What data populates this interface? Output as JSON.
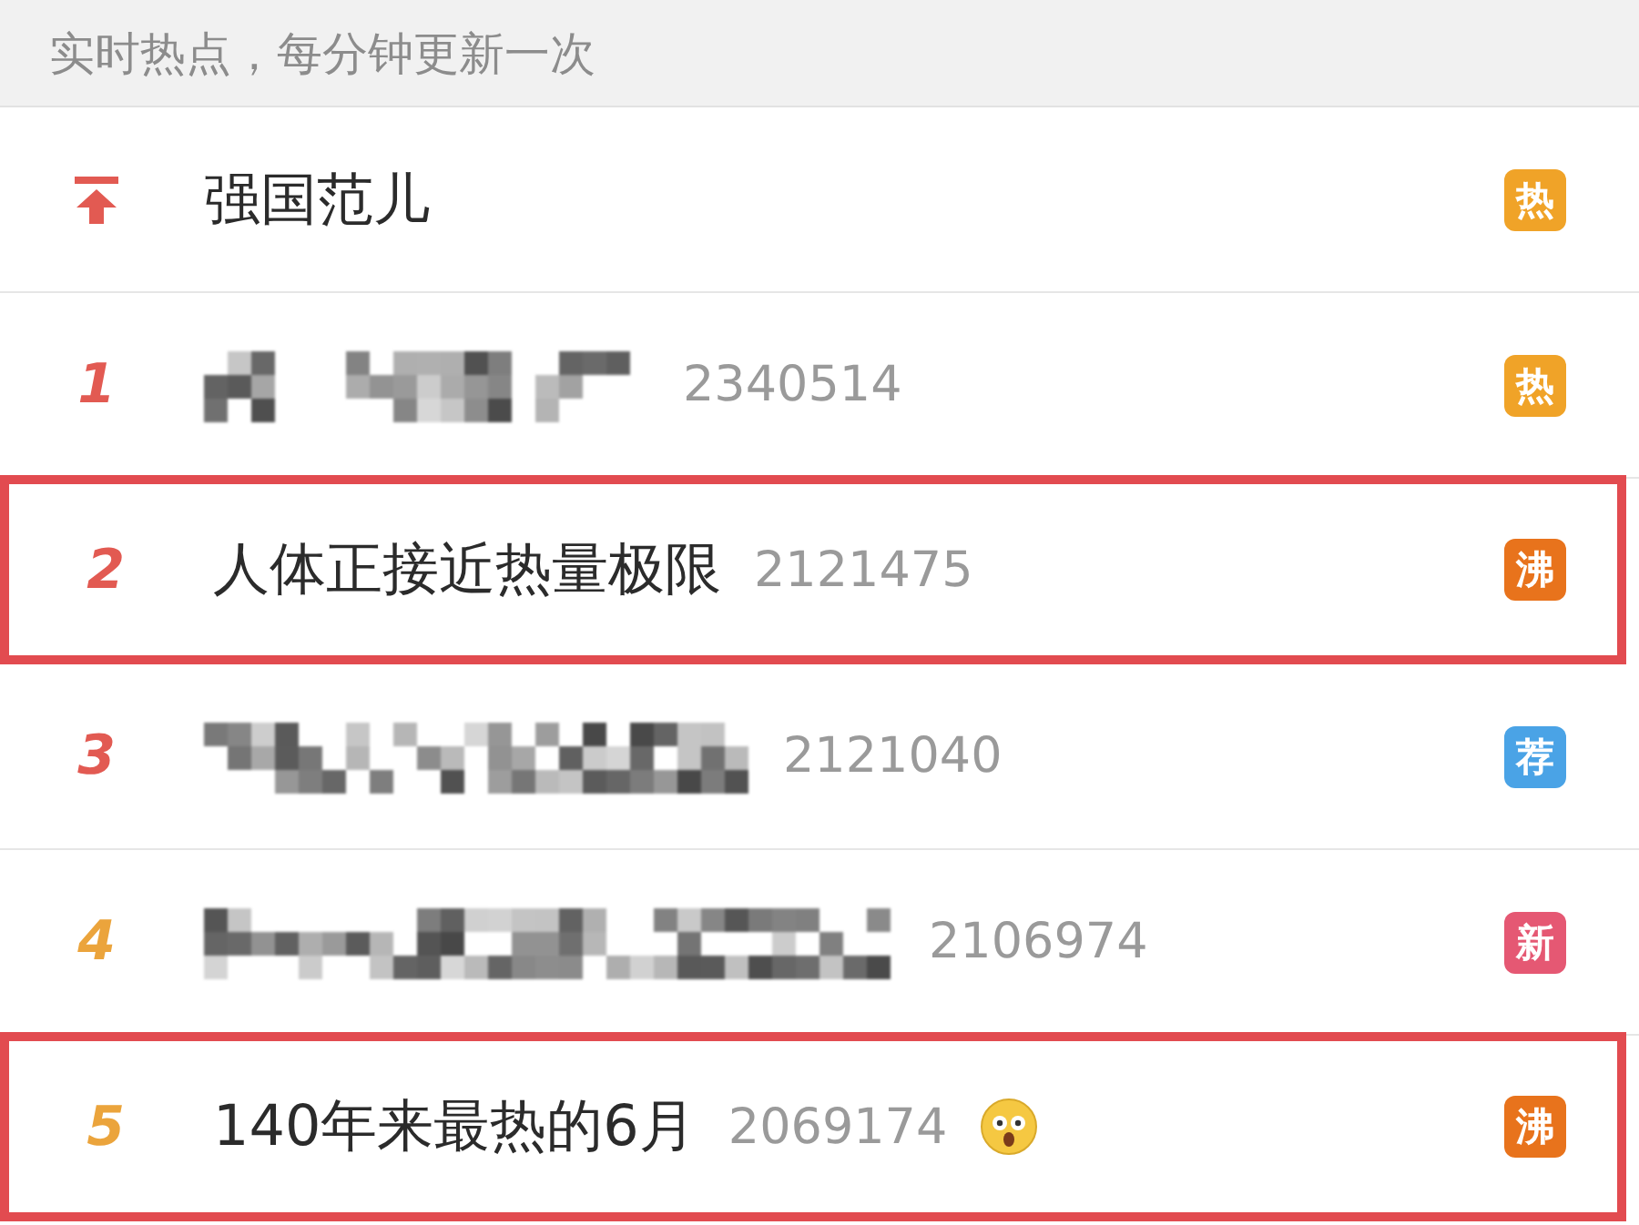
{
  "header": {
    "text": "实时热点，每分钟更新一次"
  },
  "rows": [
    {
      "kind": "pinned",
      "title": "强国范儿",
      "badge": {
        "text": "热",
        "color": "#f0a328"
      },
      "highlighted": false
    },
    {
      "kind": "blurred",
      "rank": "1",
      "color": "#e25a52",
      "count": "2340514",
      "badge": {
        "text": "热",
        "color": "#f0a328"
      },
      "highlighted": false
    },
    {
      "kind": "text",
      "rank": "2",
      "color": "#e25a52",
      "title": "人体正接近热量极限",
      "count": "2121475",
      "badge": {
        "text": "沸",
        "color": "#e8731c"
      },
      "highlighted": true
    },
    {
      "kind": "blurred",
      "rank": "3",
      "color": "#e25a52",
      "count": "2121040",
      "badge": {
        "text": "荐",
        "color": "#4aa3e6"
      },
      "highlighted": false
    },
    {
      "kind": "blurred",
      "rank": "4",
      "color": "#eba43c",
      "count": "2106974",
      "badge": {
        "text": "新",
        "color": "#e55873"
      },
      "highlighted": false
    },
    {
      "kind": "text",
      "rank": "5",
      "color": "#eba43c",
      "title": "140年来最热的6月",
      "count": "2069174",
      "emoji": true,
      "badge": {
        "text": "沸",
        "color": "#e8731c"
      },
      "highlighted": true
    }
  ]
}
